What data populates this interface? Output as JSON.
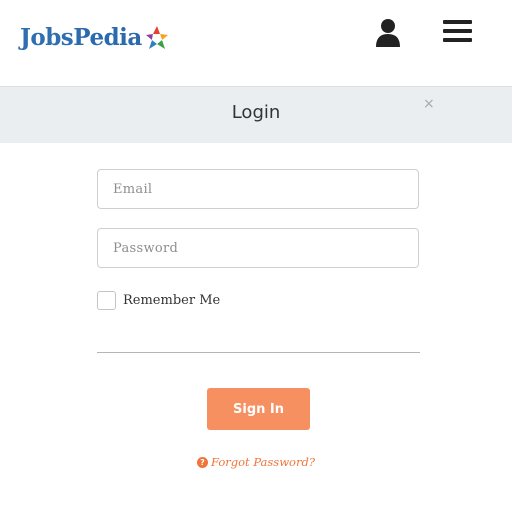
{
  "header": {
    "logo": {
      "part1": "Jobs",
      "part2": "Pedia"
    },
    "icons": {
      "user": "user-icon",
      "menu": "hamburger-menu-icon",
      "logo_mark": "star-logo-icon"
    }
  },
  "modal": {
    "title": "Login",
    "close_label": "×"
  },
  "form": {
    "email_placeholder": "Email",
    "password_placeholder": "Password",
    "remember_label": "Remember Me",
    "signin_label": "Sign In",
    "forgot_label": "Forgot Password?",
    "forgot_icon_glyph": "?"
  },
  "colors": {
    "brand_blue": "#2f6fb0",
    "accent_orange": "#f79060",
    "link_orange": "#f0753a",
    "modal_header_bg": "#ebeef0"
  }
}
